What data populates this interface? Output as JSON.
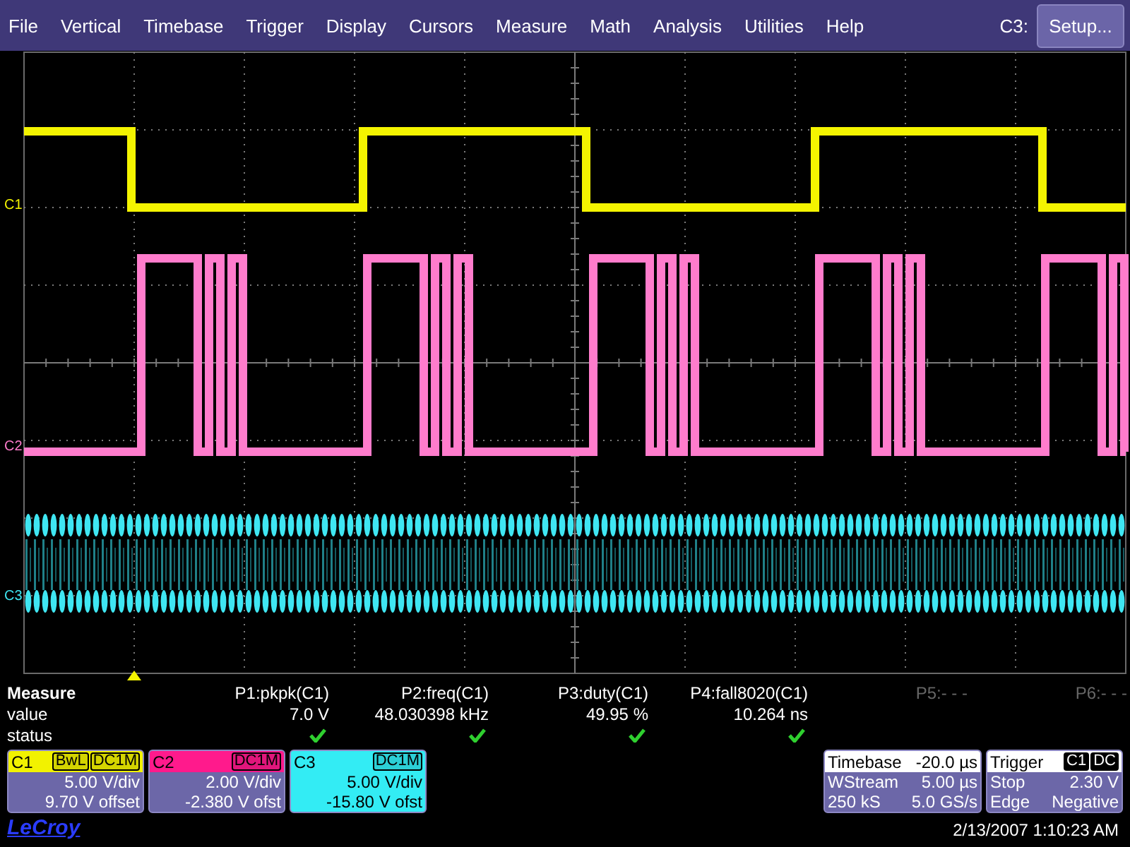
{
  "menu": {
    "items": [
      "File",
      "Vertical",
      "Timebase",
      "Trigger",
      "Display",
      "Cursors",
      "Measure",
      "Math",
      "Analysis",
      "Utilities",
      "Help"
    ],
    "channel_label": "C3:",
    "setup_button": "Setup..."
  },
  "traces": [
    {
      "label": "C1",
      "color": "#f4f400",
      "kind": "square"
    },
    {
      "label": "C2",
      "color": "#ff7ccc",
      "kind": "burst"
    },
    {
      "label": "C3",
      "color": "#3fe6f2",
      "kind": "dense"
    }
  ],
  "measure": {
    "title": "Measure",
    "row_labels": [
      "value",
      "status"
    ],
    "params": [
      {
        "label": "P1:pkpk(C1)",
        "value": "7.0 V",
        "ok": true,
        "disabled": false
      },
      {
        "label": "P2:freq(C1)",
        "value": "48.030398 kHz",
        "ok": true,
        "disabled": false
      },
      {
        "label": "P3:duty(C1)",
        "value": "49.95 %",
        "ok": true,
        "disabled": false
      },
      {
        "label": "P4:fall8020(C1)",
        "value": "10.264 ns",
        "ok": true,
        "disabled": false
      },
      {
        "label": "P5:- - -",
        "ok": false,
        "disabled": true
      },
      {
        "label": "P6:- - -",
        "ok": false,
        "disabled": true
      }
    ]
  },
  "channels": [
    {
      "name": "C1",
      "color": "#f2f200",
      "tags": [
        "BwL",
        "DC1M"
      ],
      "scale": "5.00 V/div",
      "offset": "9.70 V offset"
    },
    {
      "name": "C2",
      "color": "#ff1a8c",
      "tags": [
        "DC1M"
      ],
      "scale": "2.00 V/div",
      "offset": "-2.380 V ofst"
    },
    {
      "name": "C3",
      "color": "#33ecf4",
      "tags": [
        "DC1M"
      ],
      "scale": "5.00 V/div",
      "offset": "-15.80 V ofst"
    }
  ],
  "timebase": {
    "title": "Timebase",
    "value": "-20.0 µs",
    "rows": [
      [
        "WStream",
        "5.00 µs"
      ],
      [
        "250 kS",
        "5.0 GS/s"
      ]
    ]
  },
  "trigger": {
    "title": "Trigger",
    "tags": [
      "C1",
      "DC"
    ],
    "rows": [
      [
        "Stop",
        "2.30 V"
      ],
      [
        "Edge",
        "Negative"
      ]
    ]
  },
  "brand": "LeCroy",
  "datetime": "2/13/2007 1:10:23 AM"
}
